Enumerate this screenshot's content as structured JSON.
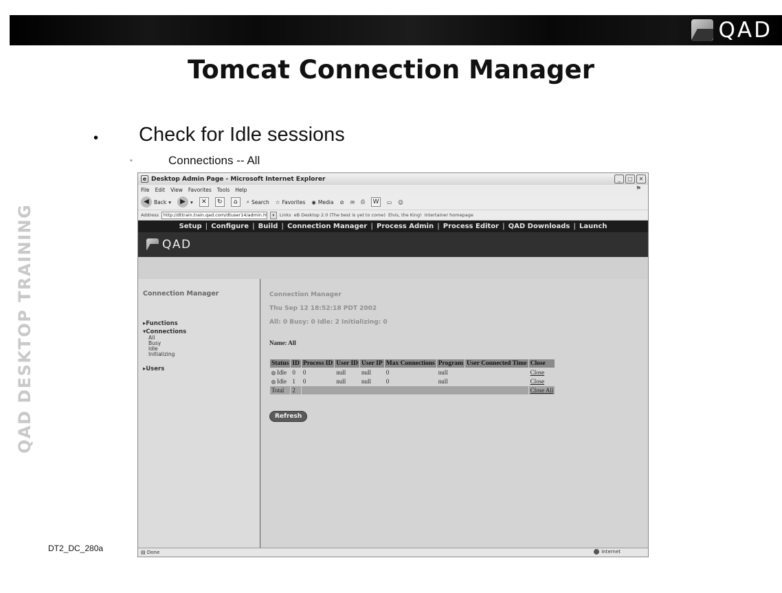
{
  "slide": {
    "logo_text": "QAD",
    "title": "Tomcat Connection Manager",
    "side_label": "QAD DESKTOP TRAINING",
    "bullet_1": "Check for Idle sessions",
    "bullet_2": "Connections -- All",
    "footer_code": "DT2_DC_280a"
  },
  "browser": {
    "window_title": "Desktop Admin Page - Microsoft Internet Explorer",
    "menu": [
      "File",
      "Edit",
      "View",
      "Favorites",
      "Tools",
      "Help"
    ],
    "toolbar": {
      "back": "Back",
      "search": "Search",
      "favorites": "Favorites",
      "media": "Media"
    },
    "address_label": "Address",
    "address_value": "http://dttrain.train.qad.com/dtuser14/admin.html",
    "links_label": "Links",
    "links": [
      "eB Desktop 2.0 (The best is yet to come)",
      "Elvis, the King!",
      "Intertainer homepage"
    ],
    "status_left": "Done",
    "status_zone": "Internet"
  },
  "app": {
    "nav": [
      "Setup",
      "Configure",
      "Build",
      "Connection Manager",
      "Process Admin",
      "Process Editor",
      "QAD Downloads",
      "Launch"
    ],
    "logo_text": "QAD",
    "left_title": "Connection Manager",
    "functions_label": "Functions",
    "connections_label": "Connections",
    "connection_items": [
      "All",
      "Busy",
      "Idle",
      "Initializing"
    ],
    "users_label": "Users",
    "main_title": "Connection Manager",
    "timestamp": "Thu Sep 12 18:52:18 PDT 2002",
    "summary": "All: 0 Busy: 0 Idle: 2 Initializing: 0",
    "name_label": "Name: All",
    "table": {
      "headers": [
        "Status",
        "ID",
        "Process ID",
        "User ID",
        "User IP",
        "Max Connections",
        "Program",
        "User Connected Time",
        "Close"
      ],
      "rows": [
        {
          "status": "Idle",
          "id": "0",
          "process_id": "0",
          "user_id": "null",
          "user_ip": "null",
          "max_connections": "0",
          "program": "null",
          "connected_time": "",
          "close": "Close"
        },
        {
          "status": "Idle",
          "id": "1",
          "process_id": "0",
          "user_id": "null",
          "user_ip": "null",
          "max_connections": "0",
          "program": "null",
          "connected_time": "",
          "close": "Close"
        }
      ],
      "total_label": "Total",
      "total_value": "2",
      "close_all": "Close All"
    },
    "refresh_label": "Refresh"
  }
}
